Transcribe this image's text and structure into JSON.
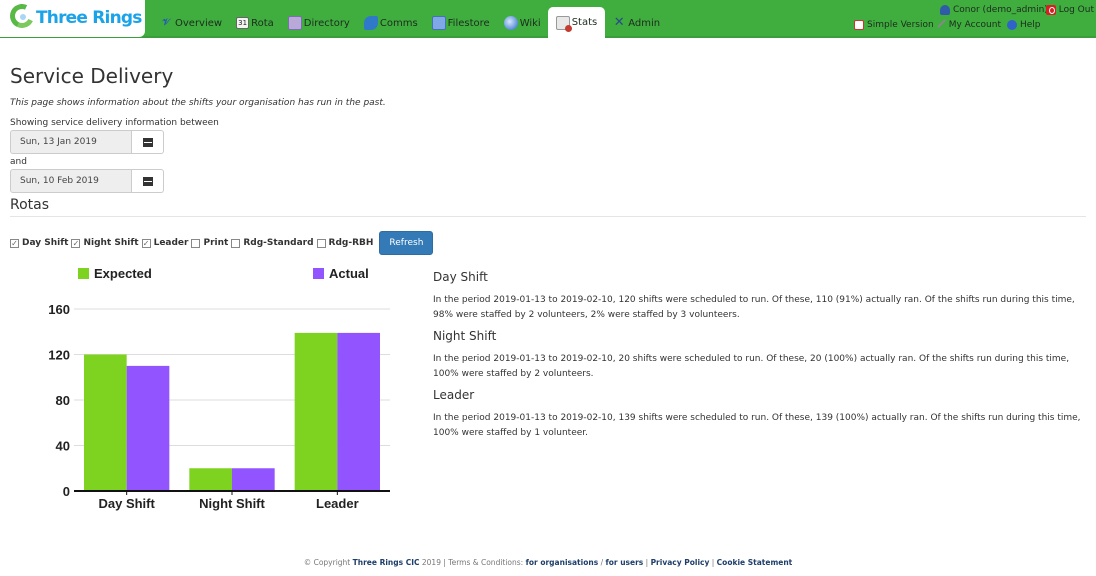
{
  "brand": {
    "name": "Three Rings",
    "accent": "#3fae3f"
  },
  "nav": {
    "items": [
      {
        "label": "Overview",
        "icon": "overview-icon"
      },
      {
        "label": "Rota",
        "icon": "calendar-icon",
        "icon_text": "31"
      },
      {
        "label": "Directory",
        "icon": "directory-icon"
      },
      {
        "label": "Comms",
        "icon": "comms-icon"
      },
      {
        "label": "Filestore",
        "icon": "folder-icon"
      },
      {
        "label": "Wiki",
        "icon": "globe-icon"
      },
      {
        "label": "Stats",
        "icon": "stats-icon",
        "active": true
      },
      {
        "label": "Admin",
        "icon": "tools-icon",
        "icon_text": "✕"
      }
    ]
  },
  "user": {
    "name": "Conor (demo_admin)",
    "logout": "Log Out",
    "simple_version": "Simple Version",
    "my_account": "My Account",
    "help": "Help"
  },
  "page": {
    "title": "Service Delivery",
    "intro": "This page shows information about the shifts your organisation has run in the past.",
    "between_label": "Showing service delivery information between",
    "start_date": "Sun, 13 Jan 2019",
    "and_label": "and",
    "end_date": "Sun, 10 Feb 2019",
    "rotas_heading": "Rotas",
    "rotas": [
      {
        "label": "Day Shift",
        "checked": true
      },
      {
        "label": "Night Shift",
        "checked": true
      },
      {
        "label": "Leader",
        "checked": true
      },
      {
        "label": "Print",
        "checked": false
      },
      {
        "label": "Rdg-Standard",
        "checked": false
      },
      {
        "label": "Rdg-RBH",
        "checked": false
      }
    ],
    "refresh_label": "Refresh"
  },
  "summaries": [
    {
      "title": "Day Shift",
      "text": "In the period 2019-01-13 to 2019-02-10, 120 shifts were scheduled to run. Of these, 110 (91%) actually ran. Of the shifts run during this time, 98% were staffed by 2 volunteers, 2% were staffed by 3 volunteers."
    },
    {
      "title": "Night Shift",
      "text": "In the period 2019-01-13 to 2019-02-10, 20 shifts were scheduled to run. Of these, 20 (100%) actually ran. Of the shifts run during this time, 100% were staffed by 2 volunteers."
    },
    {
      "title": "Leader",
      "text": "In the period 2019-01-13 to 2019-02-10, 139 shifts were scheduled to run. Of these, 139 (100%) actually ran. Of the shifts run during this time, 100% were staffed by 1 volunteer."
    }
  ],
  "chart_data": {
    "type": "bar",
    "title": "",
    "xlabel": "",
    "ylabel": "",
    "categories": [
      "Day Shift",
      "Night Shift",
      "Leader"
    ],
    "series": [
      {
        "name": "Expected",
        "values": [
          120,
          20,
          139
        ],
        "color": "#7ed321"
      },
      {
        "name": "Actual",
        "values": [
          110,
          20,
          139
        ],
        "color": "#9254ff"
      }
    ],
    "ylim": [
      0,
      160
    ],
    "yticks": [
      0,
      40,
      80,
      120,
      160
    ],
    "grid": true,
    "legend": "top"
  },
  "footer": {
    "copyright": "© Copyright",
    "org": "Three Rings CIC",
    "year": "2019",
    "terms": "Terms & Conditions:",
    "for_orgs": "for organisations",
    "slash": "/",
    "for_users": "for users",
    "privacy": "Privacy Policy",
    "cookie": "Cookie Statement"
  }
}
